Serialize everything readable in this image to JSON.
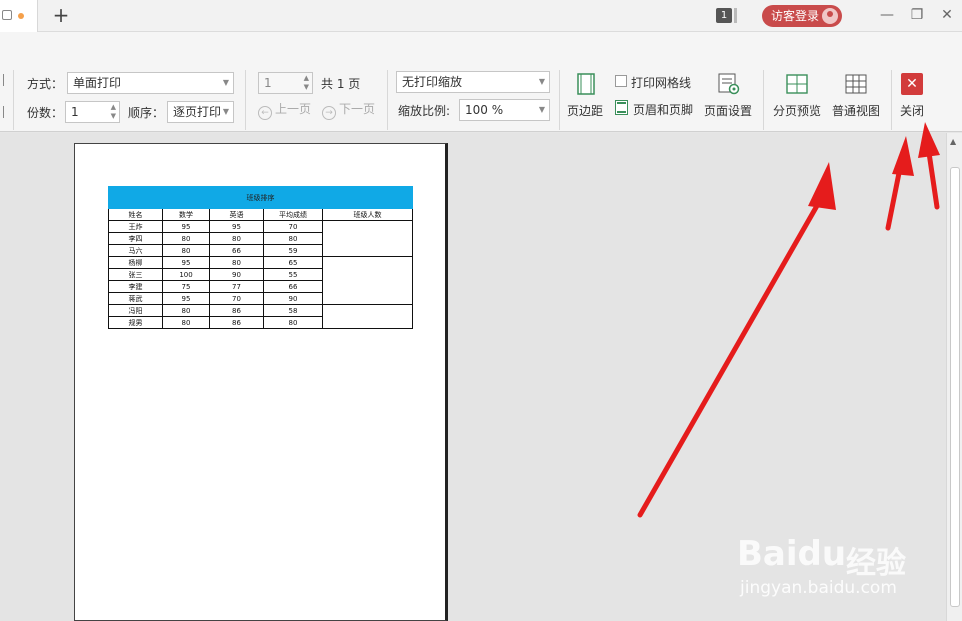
{
  "titlebar": {
    "new_tab": "+",
    "badge_count": "1",
    "login_label": "访客登录",
    "minimize": "—",
    "restore": "❐",
    "close": "✕"
  },
  "toolbar": {
    "mode_label": "方式：",
    "mode_value": "单面打印",
    "copies_label": "份数：",
    "copies_value": "1",
    "order_label": "顺序：",
    "order_value": "逐页打印",
    "page_value": "1",
    "total_pages": "共 1 页",
    "prev_page": "上一页",
    "next_page": "下一页",
    "scale_mode": "无打印缩放",
    "zoom_label": "缩放比例:",
    "zoom_value": "100 %",
    "margins": "页边距",
    "print_gridlines": "打印网格线",
    "header_footer": "页眉和页脚",
    "page_setup": "页面设置",
    "page_break_preview": "分页预览",
    "normal_view": "普通视图",
    "close_label": "关闭",
    "close_icon": "✕"
  },
  "sheet": {
    "title": "班级排序",
    "headers": [
      "姓名",
      "数学",
      "英语",
      "平均成绩",
      "班级人数"
    ],
    "rows": [
      [
        "王炸",
        "95",
        "95",
        "70"
      ],
      [
        "李四",
        "80",
        "80",
        "80"
      ],
      [
        "马六",
        "80",
        "66",
        "59"
      ],
      [
        "杨柳",
        "95",
        "80",
        "65"
      ],
      [
        "张三",
        "100",
        "90",
        "55"
      ],
      [
        "李建",
        "75",
        "77",
        "66"
      ],
      [
        "蒋武",
        "95",
        "70",
        "90"
      ],
      [
        "冯阳",
        "80",
        "86",
        "58"
      ],
      [
        "规男",
        "80",
        "86",
        "80"
      ]
    ]
  },
  "watermark": {
    "brand": "Baidu",
    "brand_cn": "经验",
    "url": "jingyan.baidu.com"
  },
  "colors": {
    "annotation_arrow": "#e51c1c",
    "close_button": "#d23b3b",
    "table_title_fill": "#10a9e6",
    "login_pill": "#c94b4b"
  }
}
